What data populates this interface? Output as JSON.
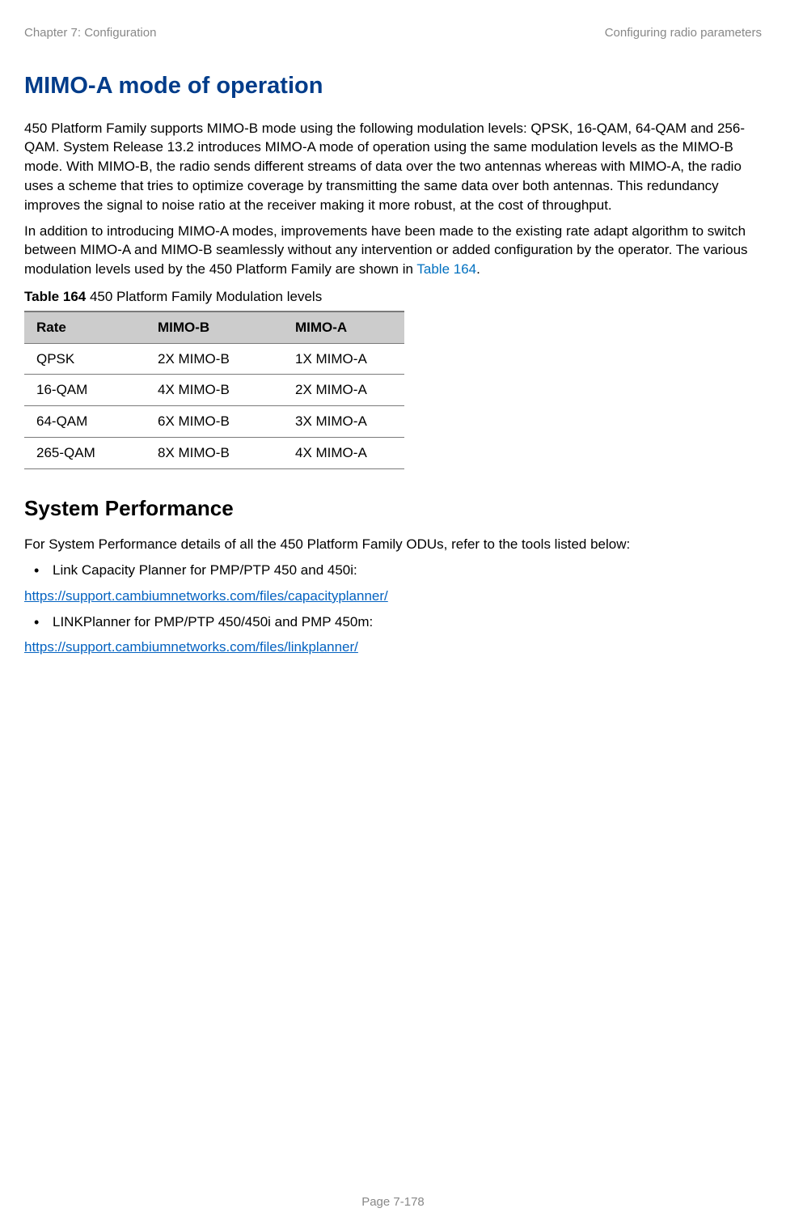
{
  "header": {
    "left": "Chapter 7:  Configuration",
    "right": "Configuring radio parameters"
  },
  "h1": "MIMO-A mode of operation",
  "p1a": "450 Platform Family supports MIMO-B mode using the following modulation levels: QPSK, 16-QAM, 64-QAM and 256-QAM. System Release 13.2 introduces MIMO-A mode of operation using the same modulation levels as the MIMO-B mode. With MIMO-B, the radio sends different streams of data over the two antennas whereas with MIMO-A, the radio uses a scheme that tries to optimize coverage by transmitting the same data over both antennas. This redundancy improves the signal to noise ratio at the receiver making it more robust, at the cost of throughput.",
  "p1b_pre": "In addition to introducing MIMO-A modes, improvements have been made to the existing rate adapt algorithm to switch between MIMO-A and MIMO-B seamlessly without any intervention or added configuration by the operator. The various modulation levels used by the 450 Platform Family are shown in ",
  "p1b_xref": "Table 164",
  "p1b_post": ".",
  "table_caption_strong": "Table 164",
  "table_caption_rest": " 450 Platform Family Modulation levels",
  "table": {
    "headers": [
      "Rate",
      "MIMO-B",
      "MIMO-A"
    ],
    "rows": [
      [
        "QPSK",
        "2X MIMO-B",
        "1X MIMO-A"
      ],
      [
        "16-QAM",
        "4X MIMO-B",
        "2X MIMO-A"
      ],
      [
        "64-QAM",
        "6X MIMO-B",
        "3X MIMO-A"
      ],
      [
        "265-QAM",
        "8X MIMO-B",
        "4X MIMO-A"
      ]
    ]
  },
  "h2": "System Performance",
  "p2": "For System Performance details of all the 450 Platform Family ODUs, refer to the tools listed below:",
  "bullets": [
    "Link Capacity Planner for PMP/PTP 450 and 450i:",
    "LINKPlanner for PMP/PTP 450/450i and PMP 450m:"
  ],
  "links": [
    "https://support.cambiumnetworks.com/files/capacityplanner/",
    "https://support.cambiumnetworks.com/files/linkplanner/"
  ],
  "footer": "Page 7-178"
}
